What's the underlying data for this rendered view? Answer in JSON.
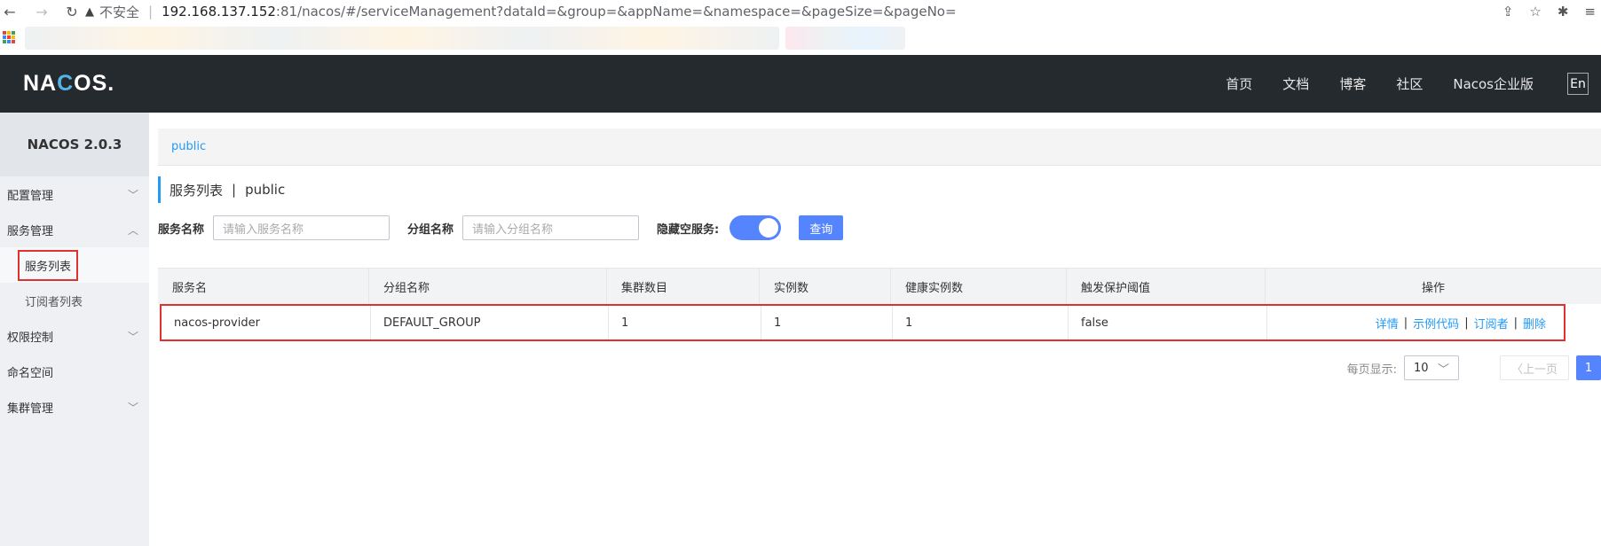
{
  "browser": {
    "insecure_label": "不安全",
    "host": "192.168.137.152",
    "path": ":81/nacos/#/serviceManagement?dataId=&group=&appName=&namespace=&pageSize=&pageNo="
  },
  "header": {
    "logo_pre": "NA",
    "logo_c": "C",
    "logo_post": "OS.",
    "nav": [
      "首页",
      "文档",
      "博客",
      "社区",
      "Nacos企业版"
    ],
    "lang": "En"
  },
  "sidebar": {
    "version": "NACOS 2.0.3",
    "items": [
      {
        "label": "配置管理"
      },
      {
        "label": "服务管理"
      },
      {
        "label": "服务列表"
      },
      {
        "label": "订阅者列表"
      },
      {
        "label": "权限控制"
      },
      {
        "label": "命名空间"
      },
      {
        "label": "集群管理"
      }
    ]
  },
  "main": {
    "namespace_tab": "public",
    "title": "服务列表",
    "title_sep": "|",
    "title_ns": "public",
    "search": {
      "service_label": "服务名称",
      "service_placeholder": "请输入服务名称",
      "group_label": "分组名称",
      "group_placeholder": "请输入分组名称",
      "hide_empty_label": "隐藏空服务:",
      "query_button": "查询"
    },
    "table": {
      "headers": [
        "服务名",
        "分组名称",
        "集群数目",
        "实例数",
        "健康实例数",
        "触发保护阈值",
        "操作"
      ],
      "rows": [
        {
          "service": "nacos-provider",
          "group": "DEFAULT_GROUP",
          "clusters": "1",
          "instances": "1",
          "healthy": "1",
          "threshold": "false"
        }
      ],
      "actions": [
        "详情",
        "示例代码",
        "订阅者",
        "删除"
      ],
      "action_sep": "|"
    },
    "pager": {
      "per_page_label": "每页显示:",
      "per_page_value": "10",
      "prev": "上一页",
      "current_page": "1"
    }
  }
}
